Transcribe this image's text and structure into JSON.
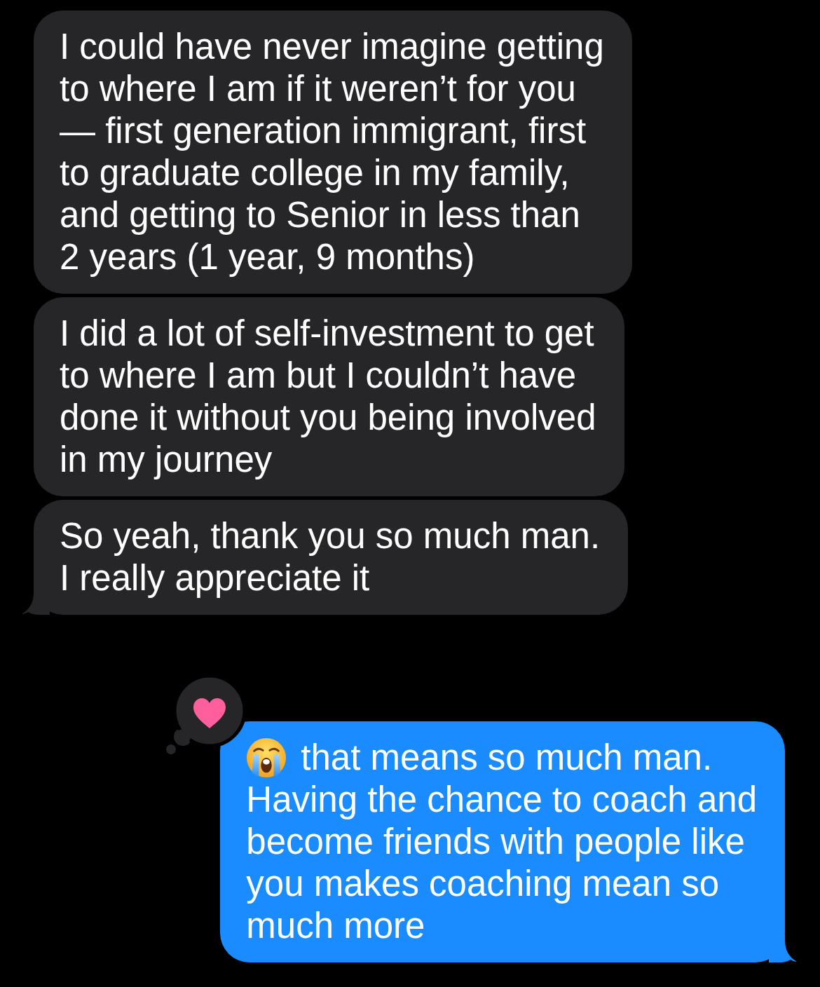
{
  "messages": [
    {
      "kind": "received",
      "text": "I could have never imagine getting\nto where I am if it weren’t for you\n— first generation immigrant, first\nto graduate college in my family,\nand getting to Senior in less than\n2 years (1 year, 9 months)",
      "tail": false
    },
    {
      "kind": "received",
      "text": "I did a lot of self-investment to get\nto where I am but I couldn’t have\ndone it without you being involved\nin my journey",
      "tail": false
    },
    {
      "kind": "received",
      "text": "So yeah, thank you so much man.\nI really appreciate it",
      "tail": true
    },
    {
      "kind": "sent",
      "leading_emoji": true,
      "text": "that means so much man.\nHaving the chance to coach and\nbecome friends with people like\nyou makes coaching mean so\nmuch more",
      "tail": true,
      "heart_reaction": true
    }
  ]
}
